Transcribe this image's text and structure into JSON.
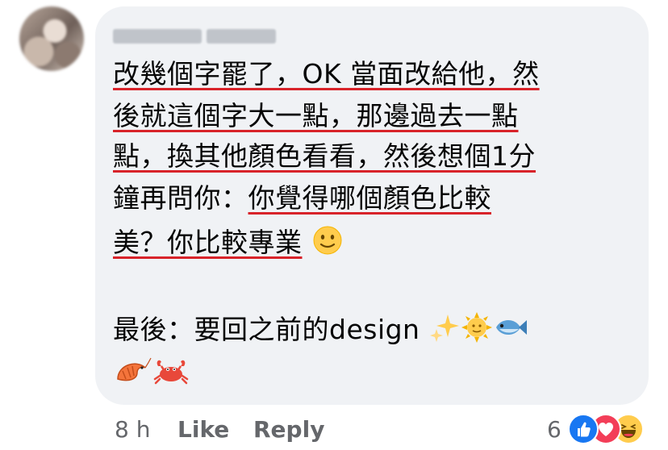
{
  "comment": {
    "author_name": "",
    "lines": [
      "改幾個字罷了，OK 當面改給他，然",
      "後就這個字大一點，那邊過去一點",
      "點，換其他顏色看看，然後想個1分",
      "鐘再問你：",
      "你覺得哪個顏色比較",
      "美？你比較專業",
      "最後：要回之前的design"
    ],
    "emojis": [
      "slightly-smiling-face",
      "sparkles",
      "sun-with-face",
      "fish",
      "shrimp",
      "crab"
    ]
  },
  "actions": {
    "time": "8 h",
    "like": "Like",
    "reply": "Reply"
  },
  "reactions": {
    "count": "6",
    "types": [
      "like",
      "love",
      "haha"
    ]
  },
  "colors": {
    "bubble": "#f0f2f5",
    "underline": "#d8232a",
    "meta_text": "#65676b",
    "like_blue": "#1877f2",
    "love_red": "#f33e58"
  }
}
